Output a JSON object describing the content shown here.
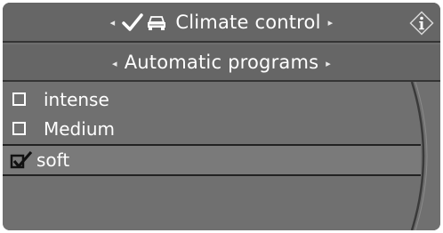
{
  "header": {
    "title": "Climate control",
    "left_arrow": "◂",
    "right_arrow": "▸"
  },
  "subheader": {
    "title": "Automatic programs",
    "left_arrow": "◂",
    "right_arrow": "▸"
  },
  "options": [
    {
      "label": "intense",
      "checked": false
    },
    {
      "label": "Medium",
      "checked": false
    },
    {
      "label": "soft",
      "checked": true
    }
  ],
  "colors": {
    "background": "#6e6e6e",
    "header": "#666666",
    "text": "#ffffff",
    "divider": "#343434"
  },
  "icons": {
    "header_check": "check-icon",
    "header_car": "car-icon",
    "info": "info-icon",
    "unchecked": "checkbox-unchecked-icon",
    "checked": "checkbox-checked-icon"
  }
}
